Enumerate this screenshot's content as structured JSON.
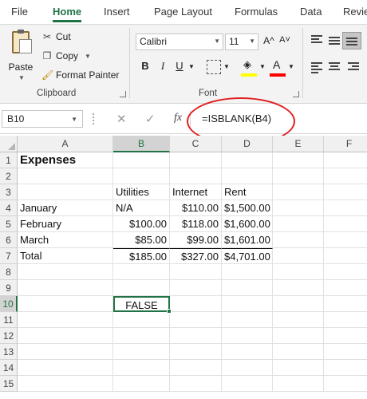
{
  "tabs": [
    "File",
    "Home",
    "Insert",
    "Page Layout",
    "Formulas",
    "Data",
    "Revie"
  ],
  "active_tab": "Home",
  "clipboard": {
    "paste_label": "Paste",
    "cut_label": "Cut",
    "copy_label": "Copy",
    "format_painter_label": "Format Painter",
    "group_label": "Clipboard"
  },
  "font": {
    "font_name": "Calibri",
    "font_size": "11",
    "grow_label": "A^",
    "shrink_label": "A˅",
    "bold_label": "B",
    "italic_label": "I",
    "underline_label": "U",
    "font_color_label": "A",
    "group_label": "Font"
  },
  "formula_bar": {
    "name_box": "B10",
    "fx_label": "fx",
    "formula": "=ISBLANK(B4)"
  },
  "columns": [
    "A",
    "B",
    "C",
    "D",
    "E",
    "F"
  ],
  "selected_column": "B",
  "selected_row": "10",
  "rows": [
    {
      "n": "1",
      "A": "Expenses",
      "B": "",
      "C": "",
      "D": ""
    },
    {
      "n": "2",
      "A": "",
      "B": "",
      "C": "",
      "D": ""
    },
    {
      "n": "3",
      "A": "",
      "B": "Utilities",
      "C": "Internet",
      "D": "Rent"
    },
    {
      "n": "4",
      "A": "January",
      "B": "N/A",
      "C": "$110.00",
      "D": "$1,500.00"
    },
    {
      "n": "5",
      "A": "February",
      "B": "$100.00",
      "C": "$118.00",
      "D": "$1,600.00"
    },
    {
      "n": "6",
      "A": "March",
      "B": "$85.00",
      "C": "$99.00",
      "D": "$1,601.00"
    },
    {
      "n": "7",
      "A": "Total",
      "B": "$185.00",
      "C": "$327.00",
      "D": "$4,701.00"
    },
    {
      "n": "8",
      "A": "",
      "B": "",
      "C": "",
      "D": ""
    },
    {
      "n": "9",
      "A": "",
      "B": "",
      "C": "",
      "D": ""
    },
    {
      "n": "10",
      "A": "",
      "B": "FALSE",
      "C": "",
      "D": ""
    },
    {
      "n": "11",
      "A": "",
      "B": "",
      "C": "",
      "D": ""
    },
    {
      "n": "12",
      "A": "",
      "B": "",
      "C": "",
      "D": ""
    },
    {
      "n": "13",
      "A": "",
      "B": "",
      "C": "",
      "D": ""
    },
    {
      "n": "14",
      "A": "",
      "B": "",
      "C": "",
      "D": ""
    },
    {
      "n": "15",
      "A": "",
      "B": "",
      "C": "",
      "D": ""
    }
  ],
  "colors": {
    "accent": "#217346",
    "annotation": "#e02020",
    "highlight_yellow": "#ffff00",
    "font_red": "#ff0000"
  }
}
